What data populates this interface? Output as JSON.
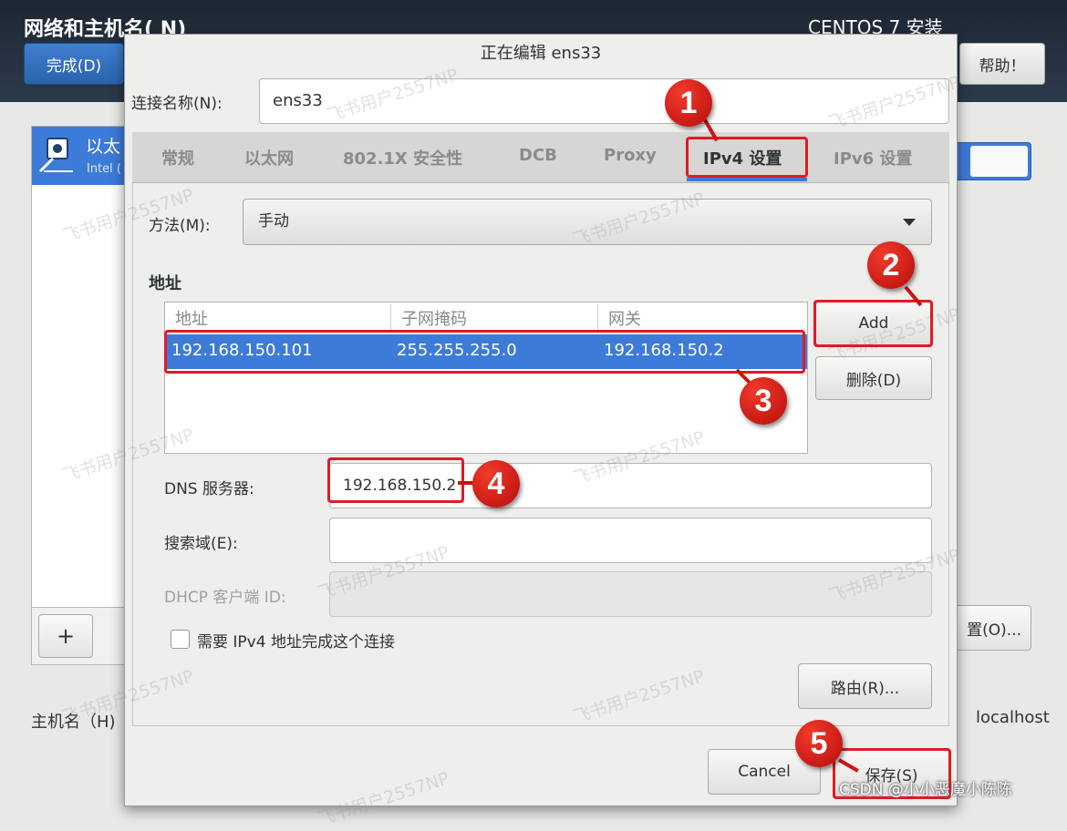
{
  "background": {
    "title": "网络和主机名( N)",
    "done_button": "完成(D)",
    "install_title": "CENTOS 7 安装",
    "help_button": "帮助！",
    "network_item_name": "以太",
    "network_item_sub": "Intel (",
    "add_button": "+",
    "config_button": "置(O)...",
    "hostname_label": "主机名（H)",
    "hostname_value": "localhost"
  },
  "dialog": {
    "title": "正在编辑 ens33",
    "connection_name_label": "连接名称(N):",
    "connection_name_value": "ens33",
    "tabs": [
      "常规",
      "以太网",
      "802.1X 安全性",
      "DCB",
      "Proxy",
      "IPv4 设置",
      "IPv6 设置"
    ],
    "active_tab": "IPv4 设置",
    "method_label": "方法(M):",
    "method_value": "手动",
    "address_heading": "地址",
    "address_columns": [
      "地址",
      "子网掩码",
      "网关"
    ],
    "address_rows": [
      {
        "address": "192.168.150.101",
        "netmask": "255.255.255.0",
        "gateway": "192.168.150.2"
      }
    ],
    "add_button": "Add",
    "delete_button": "删除(D)",
    "dns_label": "DNS 服务器:",
    "dns_value": "192.168.150.2",
    "search_label": "搜索域(E):",
    "search_value": "",
    "dhcp_label": "DHCP 客户端 ID:",
    "dhcp_value": "",
    "require_ipv4_label": "需要 IPv4 地址完成这个连接",
    "require_ipv4_checked": false,
    "routes_button": "路由(R)...",
    "cancel_button": "Cancel",
    "save_button": "保存(S)"
  },
  "annotations": {
    "steps": [
      "1",
      "2",
      "3",
      "4",
      "5"
    ],
    "color": "#e01b24"
  },
  "watermark": "飞书用户2557NP",
  "credit": "CSDN @小小恶魔小陈陈",
  "colors": {
    "accent": "#3d7bd8",
    "topbar": "#1d2733",
    "annotation_red": "#e01b24"
  }
}
